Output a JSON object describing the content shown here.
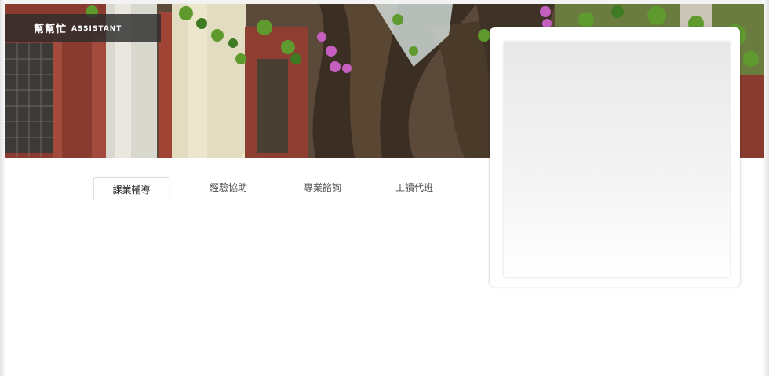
{
  "header": {
    "brand_zh": "幫幫忙",
    "brand_en": "ASSISTANT",
    "banner_image": "campus-tree-with-orchids-banner"
  },
  "tabs": [
    {
      "label": "課業輔導",
      "active": true
    },
    {
      "label": "經驗協助",
      "active": false
    },
    {
      "label": "專業諮詢",
      "active": false
    },
    {
      "label": "工讀代班",
      "active": false
    }
  ],
  "colors": {
    "logo_bg": "#2d2d2d",
    "tab_text": "#4f4f4f",
    "panel_gradient_top": "#e8e8e8"
  }
}
